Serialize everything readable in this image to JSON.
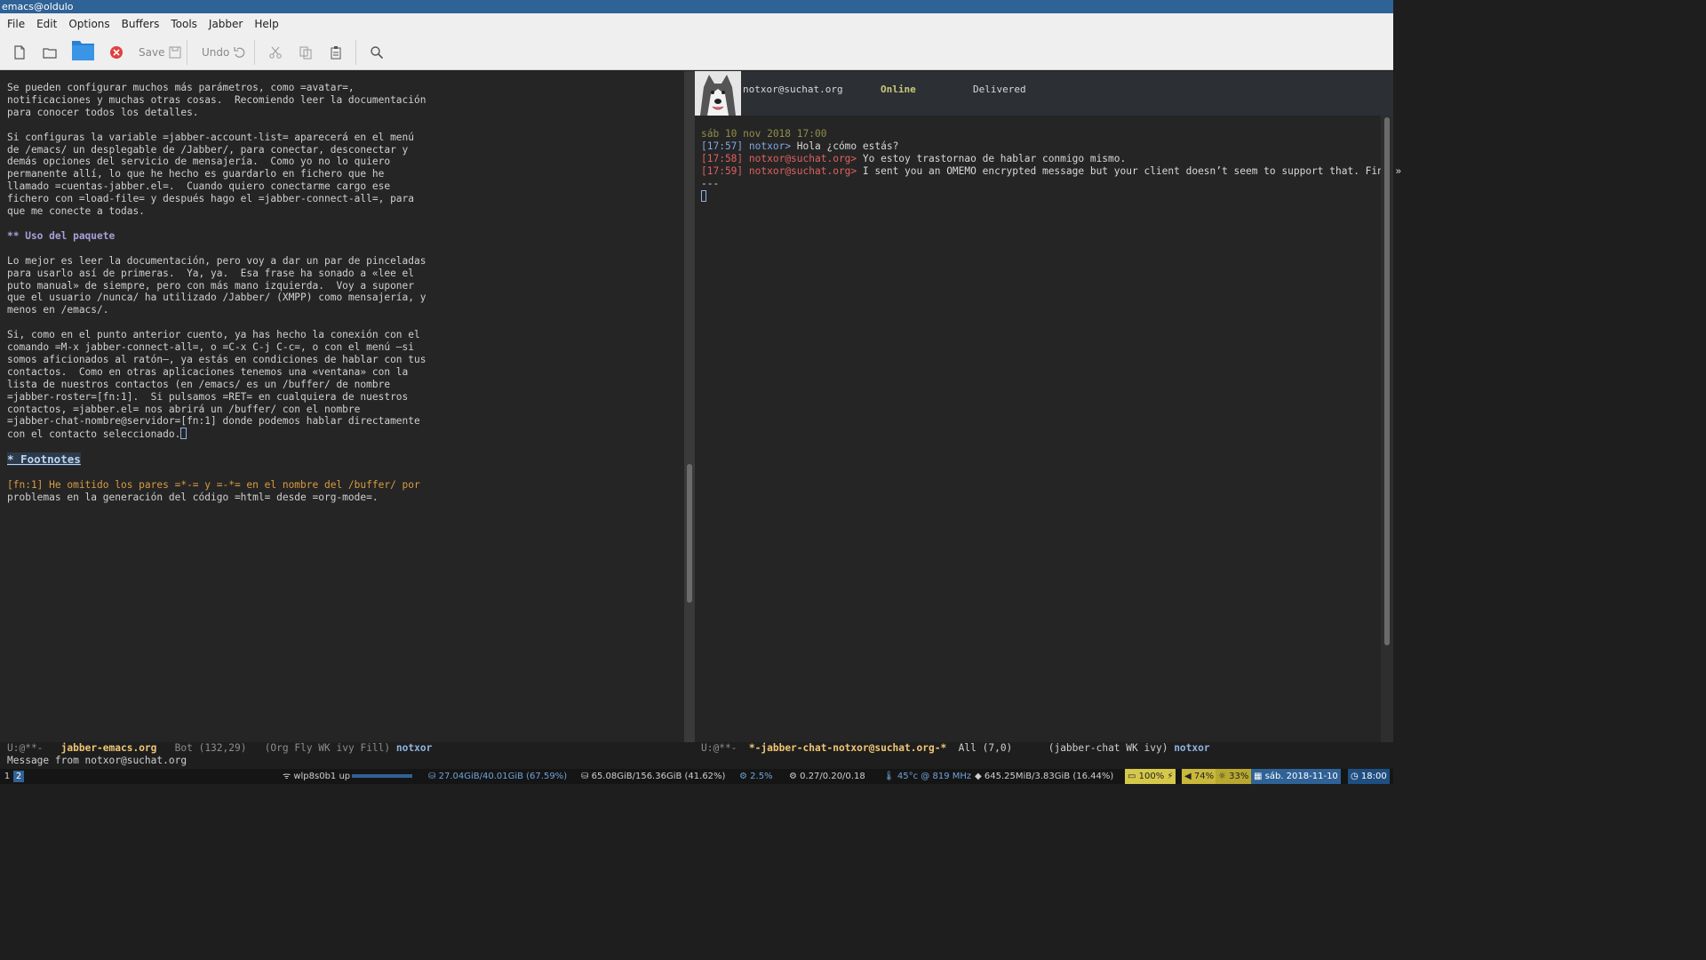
{
  "window": {
    "title": "emacs@oldulo"
  },
  "menu": [
    "File",
    "Edit",
    "Options",
    "Buffers",
    "Tools",
    "Jabber",
    "Help"
  ],
  "toolbar": {
    "save_label": "Save",
    "undo_label": "Undo"
  },
  "left_buffer": {
    "lines": [
      "Se pueden configurar muchos más parámetros, como =avatar=,",
      "notificaciones y muchas otras cosas.  Recomiendo leer la documentación",
      "para conocer todos los detalles.",
      "",
      "Si configuras la variable =jabber-account-list= aparecerá en el menú",
      "de /emacs/ un desplegable de /Jabber/, para conectar, desconectar y",
      "demás opciones del servicio de mensajería.  Como yo no lo quiero",
      "permanente allí, lo que he hecho es guardarlo en fichero que he",
      "llamado =cuentas-jabber.el=.  Cuando quiero conectarme cargo ese",
      "fichero con =load-file= y después hago el =jabber-connect-all=, para",
      "que me conecte a todas.",
      "",
      "** Uso del paquete",
      "",
      "Lo mejor es leer la documentación, pero voy a dar un par de pinceladas",
      "para usarlo así de primeras.  Ya, ya.  Esa frase ha sonado a «lee el",
      "puto manual» de siempre, pero con más mano izquierda.  Voy a suponer",
      "que el usuario /nunca/ ha utilizado /Jabber/ (XMPP) como mensajería, y",
      "menos en /emacs/.",
      "",
      "Si, como en el punto anterior cuento, ya has hecho la conexión con el",
      "comando =M-x jabber-connect-all=, o =C-x C-j C-c=, o con el menú —si",
      "somos aficionados al ratón—, ya estás en condiciones de hablar con tus",
      "contactos.  Como en otras aplicaciones tenemos una «ventana» con la",
      "lista de nuestros contactos (en /emacs/ es un /buffer/ de nombre",
      "=jabber-roster=[fn:1].  Si pulsamos =RET= en cualquiera de nuestros",
      "contactos, =jabber.el= nos abrirá un /buffer/ con el nombre",
      "=jabber-chat-nombre@servidor=[fn:1] donde podemos hablar directamente",
      "con el contacto seleccionado.",
      "",
      "* Footnotes",
      "",
      "[fn:1] He omitido los pares =*-= y =-*= en el nombre del /buffer/ por",
      "problemas en la generación del código =html= desde =org-mode=."
    ]
  },
  "chat": {
    "contact": "notxor@suchat.org",
    "presence": "Online",
    "receipt": "Delivered",
    "date": "sáb 10 nov 2018 17:00",
    "messages": [
      {
        "time": "[17:57]",
        "from": "notxor>",
        "text": " Hola ¿cómo estás?"
      },
      {
        "time": "[17:58]",
        "from": "notxor@suchat.org>",
        "text": " Yo estoy trastornao de hablar conmigo mismo."
      },
      {
        "time": "[17:59]",
        "from": "notxor@suchat.org>",
        "text": " I sent you an OMEMO encrypted message but your client doesn’t seem to support that. Find »"
      }
    ],
    "separator": "---"
  },
  "modeline_left": {
    "state": "U:@**-",
    "buffer": "jabber-emacs.org",
    "position": "Bot (132,29)",
    "modes": "(Org Fly WK ivy Fill)",
    "user": "notxor"
  },
  "modeline_right": {
    "state": "U:@**-",
    "buffer": "*-jabber-chat-notxor@suchat.org-*",
    "position": "All (7,0)",
    "modes": "(jabber-chat WK ivy)",
    "user": "notxor"
  },
  "echo": "Message from notxor@suchat.org",
  "status": {
    "workspaces": [
      "1",
      "2"
    ],
    "net": "wlp8s0b1 up",
    "disk1": "27.04GiB/40.01GiB (67.59%)",
    "disk2": "65.08GiB/156.36GiB (41.62%)",
    "cpu": "2.5%",
    "load": "0.27/0.20/0.18",
    "temp": "45°c @ 819 MHz",
    "mem": "645.25MiB/3.83GiB (16.44%)",
    "battery": "100%",
    "volume": "74%",
    "brightness": "33%",
    "date": "sáb. 2018-11-10",
    "time": "18:00"
  }
}
